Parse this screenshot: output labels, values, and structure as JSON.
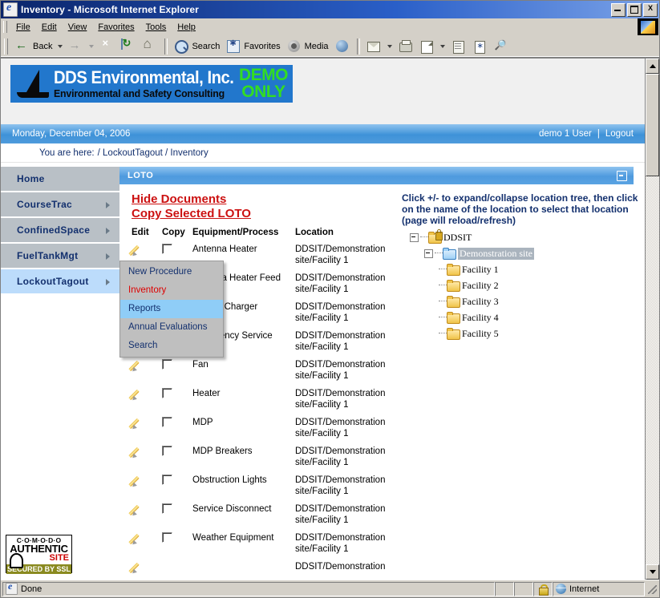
{
  "window": {
    "title": "Inventory - Microsoft Internet Explorer",
    "icon": "ie-document-icon",
    "minimize_label": "",
    "maximize_label": "",
    "close_label": "X"
  },
  "menubar": {
    "items": [
      "File",
      "Edit",
      "View",
      "Favorites",
      "Tools",
      "Help"
    ]
  },
  "toolbar": {
    "back_label": "Back",
    "search_label": "Search",
    "favorites_label": "Favorites",
    "media_label": "Media"
  },
  "banner": {
    "company": "DDS Environmental, Inc.",
    "tagline": "Environmental and Safety Consulting",
    "demo_line1": "DEMO",
    "demo_line2": "ONLY"
  },
  "datebar": {
    "date": "Monday, December 04, 2006",
    "user": "demo 1 User",
    "separator": "|",
    "logout": "Logout"
  },
  "breadcrumb": {
    "label": "You are here:",
    "path": "/ LockoutTagout / Inventory"
  },
  "sidebar": {
    "items": [
      {
        "label": "Home",
        "has_submenu": false,
        "active": false
      },
      {
        "label": "CourseTrac",
        "has_submenu": true,
        "active": false
      },
      {
        "label": "ConfinedSpace",
        "has_submenu": true,
        "active": false
      },
      {
        "label": "FuelTankMgt",
        "has_submenu": true,
        "active": false
      },
      {
        "label": "LockoutTagout",
        "has_submenu": true,
        "active": true
      }
    ]
  },
  "dropdown": {
    "items": [
      {
        "label": "New Procedure",
        "state": "normal"
      },
      {
        "label": "Inventory",
        "state": "current"
      },
      {
        "label": "Reports",
        "state": "hover"
      },
      {
        "label": "Annual Evaluations",
        "state": "normal"
      },
      {
        "label": "Search",
        "state": "normal"
      }
    ]
  },
  "panel": {
    "title": "LOTO",
    "collapse_icon": "minus-box-icon"
  },
  "actions": {
    "hide_documents": "Hide Documents",
    "copy_selected": "Copy Selected LOTO"
  },
  "table": {
    "headers": [
      "Edit",
      "Copy",
      "Equipment/Process",
      "Location"
    ],
    "rows": [
      {
        "equipment": "Antenna Heater",
        "location": "DDSIT/Demonstration site/Facility 1"
      },
      {
        "equipment": "Antenna Heater Feed",
        "location": "DDSIT/Demonstration site/Facility 1"
      },
      {
        "equipment": "Battery Charger",
        "location": "DDSIT/Demonstration site/Facility 1"
      },
      {
        "equipment": "Emergency Service",
        "location": "DDSIT/Demonstration site/Facility 1"
      },
      {
        "equipment": "Fan",
        "location": "DDSIT/Demonstration site/Facility 1"
      },
      {
        "equipment": "Heater",
        "location": "DDSIT/Demonstration site/Facility 1"
      },
      {
        "equipment": "MDP",
        "location": "DDSIT/Demonstration site/Facility 1"
      },
      {
        "equipment": "MDP Breakers",
        "location": "DDSIT/Demonstration site/Facility 1"
      },
      {
        "equipment": "Obstruction Lights",
        "location": "DDSIT/Demonstration site/Facility 1"
      },
      {
        "equipment": "Service Disconnect",
        "location": "DDSIT/Demonstration site/Facility 1"
      },
      {
        "equipment": "Weather Equipment",
        "location": "DDSIT/Demonstration site/Facility 1"
      },
      {
        "equipment": "",
        "location": "DDSIT/Demonstration"
      }
    ]
  },
  "tree": {
    "instructions": "Click +/- to expand/collapse location tree, then click on the name of the location to select that location (page will reload/refresh)",
    "root": "DDSIT",
    "site": "Demonstration site",
    "facilities": [
      "Facility 1",
      "Facility 2",
      "Facility 3",
      "Facility 4",
      "Facility 5"
    ]
  },
  "comodo": {
    "line1": "C·O·M·O·D·O",
    "line2": "AUTHENTIC",
    "line3": "SITE",
    "line4": "SECURED BY SSL"
  },
  "statusbar": {
    "status": "Done",
    "zone": "Internet"
  },
  "colors": {
    "title_bar": "#0a246a",
    "accent_blue": "#4e9ade",
    "sidebar_item": "#b9c0c6",
    "sidebar_active": "#bcdcfb",
    "action_red": "#cc1111",
    "nav_text": "#13306e",
    "dropdown_bg": "#bfbfbf",
    "dropdown_hover": "#8fcdf7",
    "logo_blue": "#2277cc",
    "demo_green": "#33dd22"
  }
}
